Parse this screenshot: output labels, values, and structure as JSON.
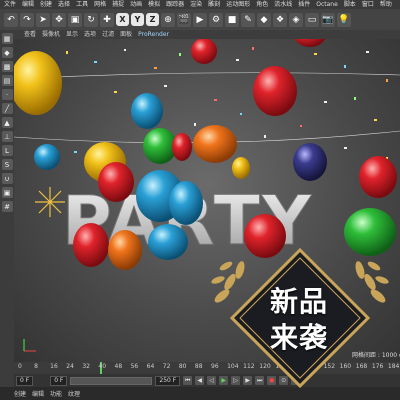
{
  "menu": [
    "文件",
    "编辑",
    "创建",
    "选择",
    "工具",
    "网格",
    "捕捉",
    "动画",
    "模拟",
    "跟踪器",
    "渲染",
    "雕刻",
    "运动图形",
    "角色",
    "流水线",
    "插件",
    "Octane",
    "脚本",
    "窗口",
    "帮助"
  ],
  "toolbar": {
    "x": "X",
    "y": "Y",
    "z": "Z"
  },
  "viewport_tabs": [
    "查看",
    "摄像机",
    "显示",
    "选项",
    "过滤",
    "面板",
    "ProRender"
  ],
  "scene": {
    "text": "PARTY",
    "grid_scale": "网格间距 : 1000 cm"
  },
  "timeline": {
    "ticks": [
      "0",
      "8",
      "16",
      "24",
      "32",
      "40",
      "48",
      "56",
      "64",
      "72",
      "80",
      "88",
      "96",
      "104",
      "112",
      "120",
      "128",
      "136",
      "144",
      "152",
      "160",
      "168",
      "176",
      "184"
    ],
    "frame_field": "0 F",
    "start_field": "0 F",
    "end_field": "250 F",
    "current_frame": "0 F"
  },
  "statusbar": [
    "创建",
    "编辑",
    "功能",
    "纹理"
  ],
  "badge": {
    "line1": "新品",
    "line2": "来袭"
  },
  "colors": {
    "accent_gold": "#c9a55a",
    "badge_dark": "#1a1c22"
  }
}
